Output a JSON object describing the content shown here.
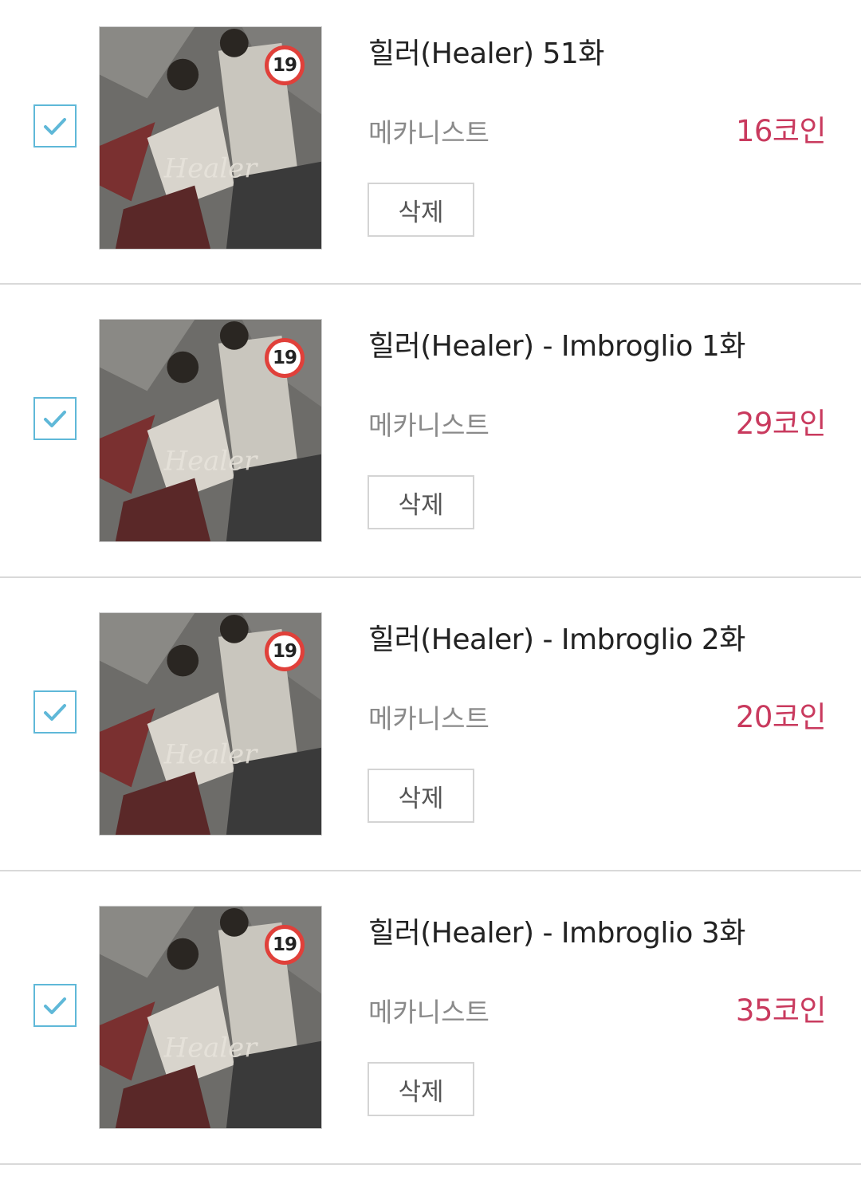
{
  "cart": {
    "items": [
      {
        "checked": true,
        "rating": "19",
        "title": "힐러(Healer) 51화",
        "author": "메카니스트",
        "price": "16코인",
        "delete_label": "삭제"
      },
      {
        "checked": true,
        "rating": "19",
        "title": "힐러(Healer) - Imbroglio 1화",
        "author": "메카니스트",
        "price": "29코인",
        "delete_label": "삭제"
      },
      {
        "checked": true,
        "rating": "19",
        "title": "힐러(Healer) - Imbroglio 2화",
        "author": "메카니스트",
        "price": "20코인",
        "delete_label": "삭제"
      },
      {
        "checked": true,
        "rating": "19",
        "title": "힐러(Healer) - Imbroglio 3화",
        "author": "메카니스트",
        "price": "35코인",
        "delete_label": "삭제"
      }
    ]
  },
  "colors": {
    "checkbox_accent": "#5fb8d8",
    "price": "#c93a5e",
    "rating_ring": "#e0403a",
    "divider": "#d9d9d9"
  },
  "icons": {
    "checkbox": "checkmark-icon",
    "rating": "age-19-badge-icon"
  }
}
